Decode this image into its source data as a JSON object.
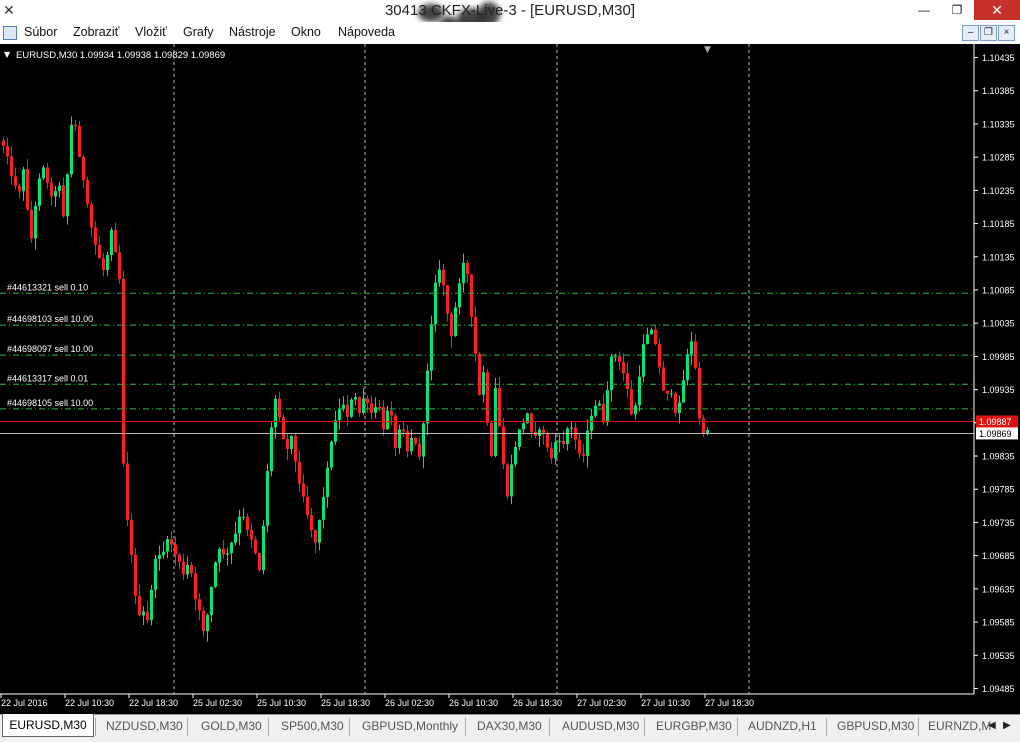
{
  "window": {
    "title": "30413 CKFX-Live-3 - [EURUSD,M30]",
    "minimize": "—",
    "restore": "❐",
    "close": "✕"
  },
  "menu": {
    "items": [
      "Súbor",
      "Zobraziť",
      "Vložiť",
      "Grafy",
      "Nástroje",
      "Okno",
      "Nápoveda"
    ],
    "mdi_min": "–",
    "mdi_restore": "❐",
    "mdi_close": "×"
  },
  "chart_info": "EURUSD,M30  1.09934 1.09938 1.09829 1.09869",
  "colors": {
    "background": "#000000",
    "bull": "#00e676",
    "bear": "#ff1f1f",
    "order_line": "#2fb84a",
    "bid_line": "#e01010",
    "ask_line": "#bbbbbb",
    "grid": "#bbbbbb",
    "axis_text": "#ffffff"
  },
  "chart_data": {
    "type": "candlestick",
    "symbol": "EURUSD",
    "timeframe": "M30",
    "ylim": [
      1.0949,
      1.1046
    ],
    "y_ticks": [
      1.10435,
      1.10385,
      1.10335,
      1.10285,
      1.10235,
      1.10185,
      1.10135,
      1.10085,
      1.10035,
      1.09985,
      1.09935,
      1.09885,
      1.09835,
      1.09785,
      1.09735,
      1.09685,
      1.09635,
      1.09585,
      1.09535,
      1.09485
    ],
    "x_labels": [
      "22 Jul 2016",
      "22 Jul 10:30",
      "22 Jul 18:30",
      "25 Jul 02:30",
      "25 Jul 10:30",
      "25 Jul 18:30",
      "26 Jul 02:30",
      "26 Jul 10:30",
      "26 Jul 18:30",
      "27 Jul 02:30",
      "27 Jul 10:30",
      "27 Jul 18:30"
    ],
    "period_separators": [
      "22 Jul 18:30",
      "25 Jul 18:30",
      "26 Jul 18:30",
      "27 Jul 18:30"
    ],
    "bid_price": 1.09887,
    "ask_price": 1.09869,
    "order_lines": [
      {
        "label": "#44613321 sell 0.10",
        "price": 1.1008
      },
      {
        "label": "#44698103 sell 10.00",
        "price": 1.10032
      },
      {
        "label": "#44698097 sell 10.00",
        "price": 1.09987
      },
      {
        "label": "#44613317 sell 0.01",
        "price": 1.09943
      },
      {
        "label": "#44698105 sell 10.00",
        "price": 1.09906
      }
    ],
    "path": [
      [
        0,
        1.1031
      ],
      [
        6,
        1.1028
      ],
      [
        12,
        1.1025
      ],
      [
        17,
        1.1022
      ],
      [
        22,
        1.1027
      ],
      [
        29,
        1.1015
      ],
      [
        36,
        1.1024
      ],
      [
        43,
        1.1027
      ],
      [
        50,
        1.1022
      ],
      [
        57,
        1.1025
      ],
      [
        63,
        1.1018
      ],
      [
        68,
        1.1031
      ],
      [
        72,
        1.1036
      ],
      [
        78,
        1.1028
      ],
      [
        84,
        1.1024
      ],
      [
        90,
        1.1018
      ],
      [
        96,
        1.1014
      ],
      [
        103,
        1.1011
      ],
      [
        110,
        1.1017
      ],
      [
        116,
        1.1012
      ],
      [
        120,
        1.1008
      ],
      [
        122,
        1.0982
      ],
      [
        124,
        1.0975
      ],
      [
        128,
        1.0972
      ],
      [
        132,
        1.0966
      ],
      [
        136,
        1.0958
      ],
      [
        140,
        1.0962
      ],
      [
        145,
        1.0958
      ],
      [
        150,
        1.0963
      ],
      [
        155,
        1.097
      ],
      [
        160,
        1.0967
      ],
      [
        165,
        1.0972
      ],
      [
        170,
        1.097
      ],
      [
        176,
        1.0968
      ],
      [
        182,
        1.0966
      ],
      [
        188,
        1.0968
      ],
      [
        193,
        1.0963
      ],
      [
        198,
        1.096
      ],
      [
        203,
        1.0956
      ],
      [
        208,
        1.0962
      ],
      [
        213,
        1.0967
      ],
      [
        218,
        1.097
      ],
      [
        223,
        1.0968
      ],
      [
        228,
        1.097
      ],
      [
        234,
        1.0972
      ],
      [
        240,
        1.0976
      ],
      [
        246,
        1.0972
      ],
      [
        252,
        1.097
      ],
      [
        258,
        1.0966
      ],
      [
        262,
        1.0973
      ],
      [
        266,
        1.0981
      ],
      [
        270,
        1.0988
      ],
      [
        274,
        1.0992
      ],
      [
        279,
        1.0988
      ],
      [
        284,
        1.0984
      ],
      [
        290,
        1.0986
      ],
      [
        295,
        1.0982
      ],
      [
        300,
        1.0978
      ],
      [
        305,
        1.0975
      ],
      [
        310,
        1.0972
      ],
      [
        315,
        1.097
      ],
      [
        320,
        1.0976
      ],
      [
        325,
        1.098
      ],
      [
        330,
        1.0986
      ],
      [
        335,
        1.0989
      ],
      [
        340,
        1.0992
      ],
      [
        346,
        1.0989
      ],
      [
        352,
        1.0994
      ],
      [
        358,
        1.099
      ],
      [
        364,
        1.0993
      ],
      [
        370,
        1.099
      ],
      [
        376,
        1.0992
      ],
      [
        382,
        1.0988
      ],
      [
        388,
        1.0991
      ],
      [
        394,
        1.0985
      ],
      [
        400,
        1.0988
      ],
      [
        406,
        1.0984
      ],
      [
        412,
        1.0987
      ],
      [
        418,
        1.0983
      ],
      [
        422,
        1.0989
      ],
      [
        426,
        1.0996
      ],
      [
        430,
        1.1003
      ],
      [
        434,
        1.1009
      ],
      [
        438,
        1.1012
      ],
      [
        442,
        1.1009
      ],
      [
        446,
        1.1005
      ],
      [
        450,
        1.1002
      ],
      [
        454,
        1.1006
      ],
      [
        458,
        1.1009
      ],
      [
        462,
        1.1012
      ],
      [
        466,
        1.1011
      ],
      [
        470,
        1.1005
      ],
      [
        474,
        1.0999
      ],
      [
        478,
        1.0993
      ],
      [
        482,
        1.0996
      ],
      [
        486,
        1.0989
      ],
      [
        490,
        1.0984
      ],
      [
        494,
        1.0994
      ],
      [
        498,
        1.0988
      ],
      [
        502,
        1.0982
      ],
      [
        506,
        1.0978
      ],
      [
        510,
        1.0982
      ],
      [
        515,
        1.0986
      ],
      [
        520,
        1.0988
      ],
      [
        526,
        1.099
      ],
      [
        532,
        1.0985
      ],
      [
        538,
        1.0988
      ],
      [
        544,
        1.0986
      ],
      [
        550,
        1.0983
      ],
      [
        556,
        1.0987
      ],
      [
        562,
        1.0985
      ],
      [
        568,
        1.0989
      ],
      [
        574,
        1.0986
      ],
      [
        580,
        1.0982
      ],
      [
        585,
        1.0986
      ],
      [
        590,
        1.099
      ],
      [
        596,
        1.0992
      ],
      [
        602,
        1.0989
      ],
      [
        606,
        1.0994
      ],
      [
        610,
        1.0998
      ],
      [
        616,
        1.0999
      ],
      [
        622,
        1.0996
      ],
      [
        628,
        1.0992
      ],
      [
        632,
        1.0988
      ],
      [
        636,
        1.0994
      ],
      [
        640,
        1.0998
      ],
      [
        644,
        1.1002
      ],
      [
        648,
        1.1001
      ],
      [
        652,
        1.1003
      ],
      [
        656,
        1.0998
      ],
      [
        660,
        1.0996
      ],
      [
        664,
        1.099
      ],
      [
        668,
        1.0995
      ],
      [
        672,
        1.0992
      ],
      [
        676,
        1.0989
      ],
      [
        680,
        1.0993
      ],
      [
        684,
        1.0997
      ],
      [
        688,
        1.1
      ],
      [
        692,
        1.1002
      ],
      [
        696,
        1.0992
      ],
      [
        700,
        1.0986
      ],
      [
        704,
        1.0989
      ],
      [
        706,
        1.0987
      ]
    ]
  },
  "tabs": {
    "active": "EURUSD,M30",
    "items": [
      "NZDUSD,M30",
      "GOLD,M30",
      "SP500,M30",
      "GBPUSD,Monthly",
      "DAX30,M30",
      "AUDUSD,M30",
      "EURGBP,M30",
      "AUDNZD,H1",
      "GBPUSD,M30",
      "EURNZD,M"
    ],
    "left_arrow": "◀",
    "right_arrow": "▶"
  }
}
